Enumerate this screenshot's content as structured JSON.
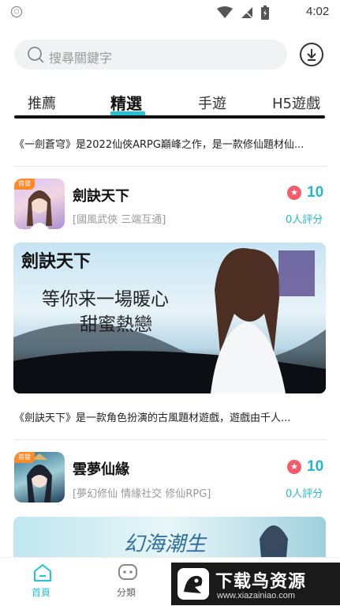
{
  "status": {
    "time": "4:02"
  },
  "search": {
    "placeholder": "搜尋關鍵字"
  },
  "tabs": [
    {
      "label": "推薦"
    },
    {
      "label": "精選"
    },
    {
      "label": "手遊"
    },
    {
      "label": "H5遊戲"
    }
  ],
  "feed": {
    "intro_1": "《一劍蒼穹》是2022仙俠ARPG巔峰之作，是一款修仙題材仙...",
    "games": [
      {
        "name": "劍訣天下",
        "tags": "[國風武俠 三端互通]",
        "score": "10",
        "ratings": "0人評分",
        "badge": "首發",
        "banner_title_1": "等你来一場暖心",
        "banner_title_2": "甜蜜熱戀",
        "banner_logo": "劍訣天下",
        "intro": "《劍訣天下》是一款角色扮演的古風題材遊戲，遊戲由千人..."
      },
      {
        "name": "雲夢仙緣",
        "tags": "[夢幻修仙 情緣社交 修仙RPG]",
        "score": "10",
        "ratings": "0人評分",
        "badge": "首發",
        "banner_logo": "幻海潮生"
      }
    ]
  },
  "bottom_nav": [
    {
      "label": "首頁",
      "icon": "home-icon"
    },
    {
      "label": "分類",
      "icon": "category-icon"
    }
  ],
  "watermark": {
    "title": "下载鸟资源",
    "url": "www.xiazainiao.com"
  },
  "colors": {
    "accent": "#22c3d6",
    "score": "#22b7cf",
    "score_icon": "#f45b6b",
    "badge": "#ff8a2a"
  }
}
